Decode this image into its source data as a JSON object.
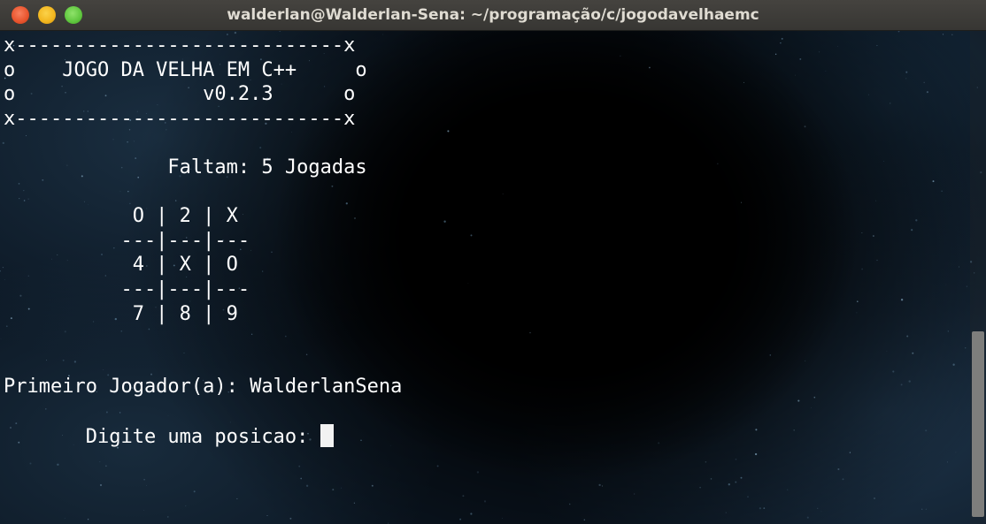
{
  "window": {
    "title": "walderlan@Walderlan-Sena: ~/programação/c/jogodavelhaemc"
  },
  "terminal": {
    "lines": [
      "x----------------------------x",
      "o    JOGO DA VELHA EM C++     o",
      "o                v0.2.3      o",
      "x----------------------------x",
      "",
      "              Faltam: 5 Jogadas",
      "",
      "           O | 2 | X",
      "          ---|---|---",
      "           4 | X | O",
      "          ---|---|---",
      "           7 | 8 | 9",
      "",
      "",
      "Primeiro Jogador(a): WalderlanSena",
      ""
    ],
    "prompt": "       Digite uma posicao: "
  },
  "colors": {
    "text": "#ffffff",
    "close_button": "#e8532c",
    "minimize_button": "#f2b51d",
    "maximize_button": "#5fc63e"
  }
}
